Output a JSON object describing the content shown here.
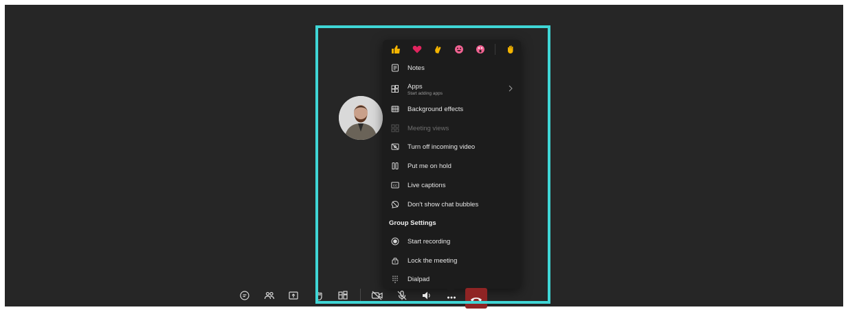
{
  "reactions": [
    {
      "name": "like",
      "icon": "thumbs-up-icon",
      "color": "#f4b400"
    },
    {
      "name": "heart",
      "icon": "heart-icon",
      "color": "#e0245e"
    },
    {
      "name": "applause",
      "icon": "clap-icon",
      "color": "#f4b400"
    },
    {
      "name": "laugh",
      "icon": "laugh-icon",
      "color": "#f06292"
    },
    {
      "name": "surprised",
      "icon": "surprised-icon",
      "color": "#f06292"
    },
    {
      "name": "raise-hand",
      "icon": "raised-hand-icon",
      "color": "#f4b400"
    }
  ],
  "menu": {
    "items": [
      {
        "label": "Notes",
        "icon": "notes-icon"
      },
      {
        "label": "Apps",
        "sublabel": "Start adding apps",
        "icon": "apps-icon"
      },
      {
        "label": "Background effects",
        "icon": "background-effects-icon"
      },
      {
        "label": "Meeting views",
        "icon": "meeting-views-icon",
        "disabled": true
      },
      {
        "label": "Turn off incoming video",
        "icon": "video-off-icon"
      },
      {
        "label": "Put me on hold",
        "icon": "hold-icon"
      },
      {
        "label": "Live captions",
        "icon": "captions-icon"
      },
      {
        "label": "Don't show chat bubbles",
        "icon": "chat-bubble-off-icon"
      }
    ],
    "group_title": "Group Settings",
    "group_items": [
      {
        "label": "Start recording",
        "icon": "record-icon"
      },
      {
        "label": "Lock the meeting",
        "icon": "lock-icon"
      },
      {
        "label": "Dialpad",
        "icon": "dialpad-icon"
      }
    ]
  },
  "toolbar": {
    "buttons": [
      "chat-icon",
      "people-icon",
      "share-icon",
      "raise-hand-icon",
      "rooms-icon",
      "camera-off-icon",
      "mic-off-icon",
      "speaker-icon",
      "more-icon"
    ],
    "hangup": "hang-up-icon"
  },
  "colors": {
    "stage_bg": "#262626",
    "menu_bg": "#1c1c1c",
    "highlight": "#3fd6d6",
    "hangup": "#8f2424"
  }
}
